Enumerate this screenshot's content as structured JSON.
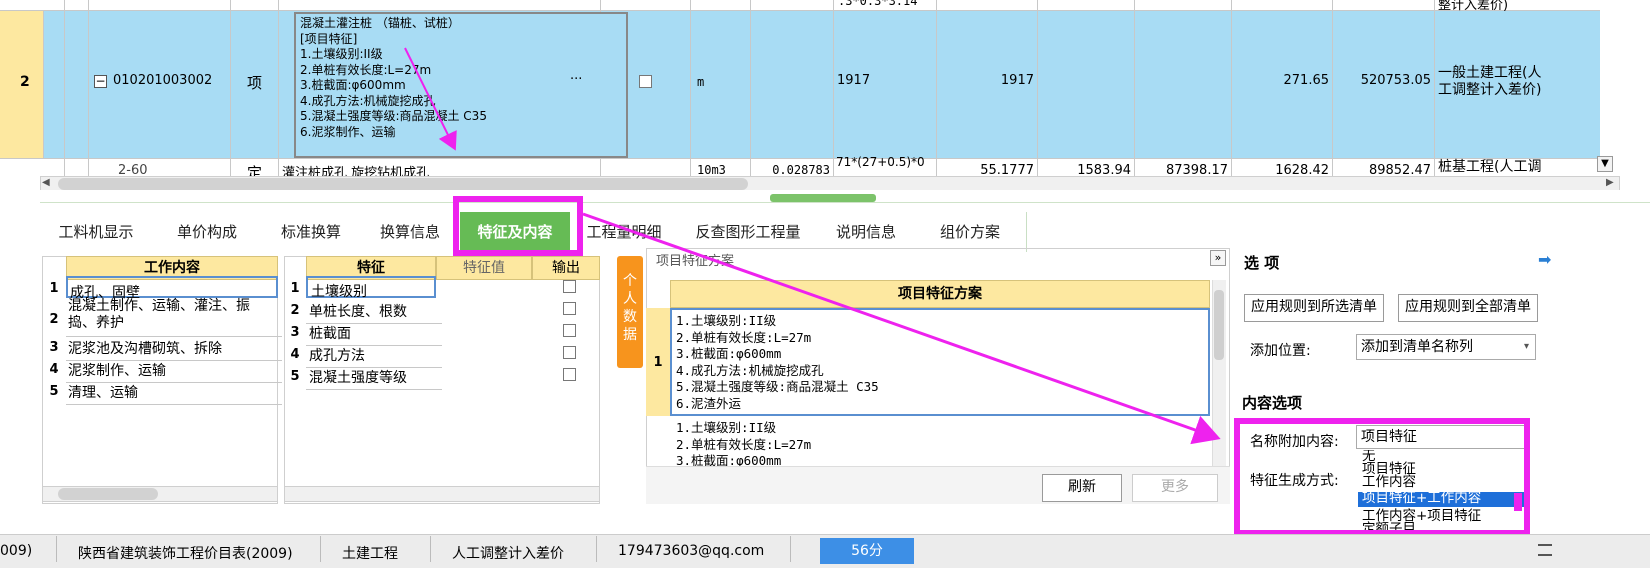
{
  "grid": {
    "partial_top_text": ".3*0.3*3.14",
    "partial_top_right": "整计入差价)",
    "selected_row": {
      "num": "2",
      "code": "010201003002",
      "type": "项",
      "description_lines": [
        "混凝土灌注桩 （锚桩、试桩）",
        "[项目特征]",
        "1.土壤级别:II级",
        "2.单桩有效长度:L=27m",
        "3.桩截面:φ600mm",
        "4.成孔方法:机械旋挖成孔",
        "5.混凝土强度等级:商品混凝土 C35",
        "6.泥浆制作、运输"
      ],
      "ellipsis": "···",
      "unit": "m",
      "quantity_expr": "1917",
      "quantity": "1917",
      "price": "271.65",
      "total": "520753.05",
      "category_lines": [
        "一般土建工程(人",
        "工调整计入差价)"
      ]
    },
    "next_row": {
      "code": "2-60",
      "type": "定",
      "desc": "灌注桩成孔 旋挖钻机成孔",
      "unit": "10m3",
      "coef": "0.028783",
      "expr_lines": [
        "71*(27+0.5)*0",
        ""
      ],
      "v1": "55.1777",
      "v2": "1583.94",
      "v3": "87398.17",
      "v4": "1628.42",
      "v5": "89852.47",
      "category": "桩基工程(人工调"
    }
  },
  "tabs": [
    {
      "label": "工料机显示"
    },
    {
      "label": "单价构成"
    },
    {
      "label": "标准换算"
    },
    {
      "label": "换算信息"
    },
    {
      "label": "特征及内容"
    },
    {
      "label": "工程量明细"
    },
    {
      "label": "反查图形工程量"
    },
    {
      "label": "说明信息"
    },
    {
      "label": "组价方案"
    }
  ],
  "work_content": {
    "header": "工作内容",
    "rows": [
      {
        "num": "1",
        "lines": [
          "成孔、固壁"
        ]
      },
      {
        "num": "2",
        "lines": [
          "混凝土制作、运输、灌注、振",
          "捣、养护"
        ]
      },
      {
        "num": "3",
        "lines": [
          "泥浆池及沟槽砌筑、拆除"
        ]
      },
      {
        "num": "4",
        "lines": [
          "泥浆制作、运输"
        ]
      },
      {
        "num": "5",
        "lines": [
          "清理、运输"
        ]
      }
    ]
  },
  "features": {
    "headers": {
      "feature": "特征",
      "value": "特征值",
      "output": "输出"
    },
    "rows": [
      {
        "num": "1",
        "name": "土壤级别"
      },
      {
        "num": "2",
        "name": "单桩长度、根数"
      },
      {
        "num": "3",
        "name": "桩截面"
      },
      {
        "num": "4",
        "name": "成孔方法"
      },
      {
        "num": "5",
        "name": "混凝土强度等级"
      }
    ]
  },
  "personal_data_label": [
    "个",
    "人",
    "数",
    "据"
  ],
  "scheme": {
    "title": "项目特征方案",
    "header": "项目特征方案",
    "collapse_glyph": "»",
    "rows": [
      {
        "num": "1",
        "lines": [
          "1.土壤级别:II级",
          "2.单桩有效长度:L=27m",
          "3.桩截面:φ600mm",
          "4.成孔方法:机械旋挖成孔",
          "5.混凝土强度等级:商品混凝土 C35",
          "6.泥渣外运"
        ]
      },
      {
        "num": "2",
        "lines": [
          "1.土壤级别:II级",
          "2.单桩有效长度:L=27m",
          "3.桩截面:φ600mm"
        ]
      }
    ],
    "refresh": "刷新",
    "more": "更多"
  },
  "options": {
    "title": "选 项",
    "apply_selected": "应用规则到所选清单",
    "apply_all": "应用规则到全部清单",
    "add_position_label": "添加位置:",
    "add_position_value": "添加到清单名称列",
    "content_options": "内容选项",
    "name_append_label": "名称附加内容:",
    "name_append_value": "项目特征",
    "feature_gen_label": "特征生成方式:",
    "dropdown_options": [
      "无",
      "项目特征",
      "工作内容",
      "项目特征+工作内容",
      "工作内容+项目特征",
      "定额子目"
    ],
    "dropdown_selected": "项目特征+工作内容"
  },
  "statusbar": {
    "items": [
      "009)",
      "陕西省建筑装饰工程价目表(2009)",
      "土建工程",
      "人工调整计入差价",
      "179473603@qq.com"
    ],
    "score": "56分"
  },
  "colors": {
    "accent_green": "#66bb55",
    "highlight_magenta": "#ee22ee",
    "row_blue": "#a8dcf4",
    "header_yellow": "#fde8a0",
    "side_orange": "#f7941d"
  }
}
